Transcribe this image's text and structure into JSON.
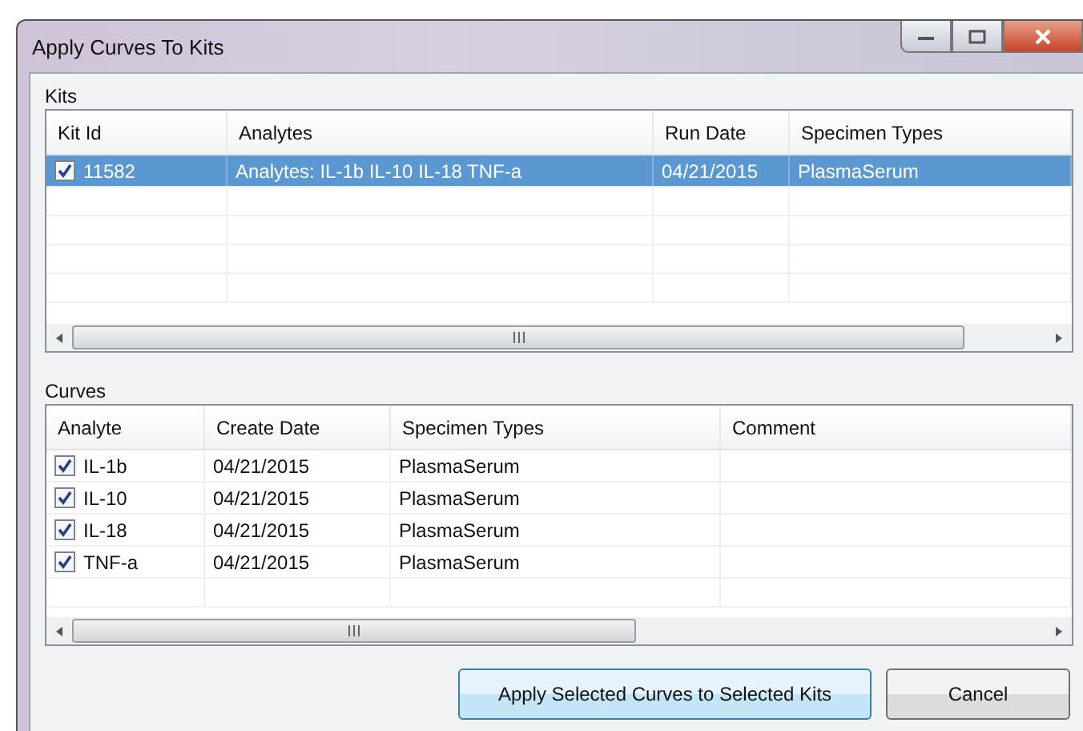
{
  "window": {
    "title": "Apply Curves To Kits"
  },
  "kits": {
    "label": "Kits",
    "columns": [
      "Kit Id",
      "Analytes",
      "Run Date",
      "Specimen Types"
    ],
    "rows": [
      {
        "checked": true,
        "selected": true,
        "cells": [
          "11582",
          "Analytes:  IL-1b IL-10 IL-18 TNF-a",
          "04/21/2015",
          "PlasmaSerum"
        ]
      }
    ]
  },
  "curves": {
    "label": "Curves",
    "columns": [
      "Analyte",
      "Create Date",
      "Specimen Types",
      "Comment"
    ],
    "rows": [
      {
        "checked": true,
        "selected": false,
        "cells": [
          "IL-1b",
          "04/21/2015",
          "PlasmaSerum",
          ""
        ]
      },
      {
        "checked": true,
        "selected": false,
        "cells": [
          "IL-10",
          "04/21/2015",
          "PlasmaSerum",
          ""
        ]
      },
      {
        "checked": true,
        "selected": false,
        "cells": [
          "IL-18",
          "04/21/2015",
          "PlasmaSerum",
          ""
        ]
      },
      {
        "checked": true,
        "selected": false,
        "cells": [
          "TNF-a",
          "04/21/2015",
          "PlasmaSerum",
          ""
        ]
      }
    ]
  },
  "buttons": [
    {
      "label": "Apply Selected Curves to Selected Kits",
      "kind": "default"
    },
    {
      "label": "Cancel",
      "kind": "normal"
    }
  ]
}
